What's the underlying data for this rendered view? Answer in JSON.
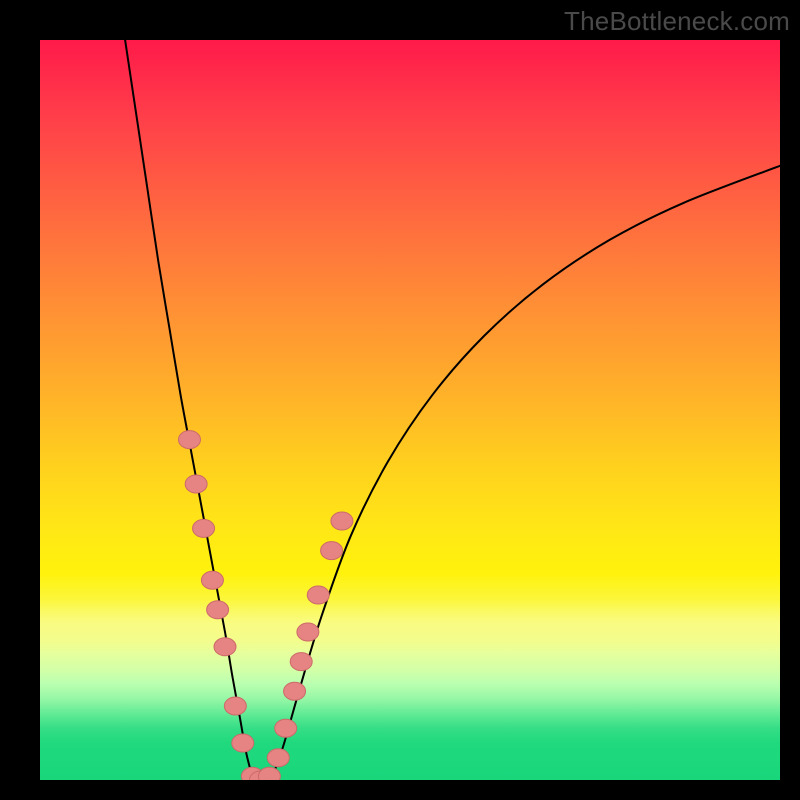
{
  "watermark": "TheBottleneck.com",
  "colors": {
    "frame": "#000000",
    "curve_stroke": "#000000",
    "marker_fill": "#e68383",
    "marker_stroke": "#cc6a6a",
    "gradient_top": "#ff1a4a",
    "gradient_bottom": "#19d67b"
  },
  "chart_data": {
    "type": "line",
    "title": "",
    "xlabel": "",
    "ylabel": "",
    "xlim": [
      0,
      100
    ],
    "ylim": [
      0,
      100
    ],
    "grid": false,
    "legend": null,
    "background": "vertical red→yellow→green gradient; green at bottom (good), red at top (bad)",
    "series": [
      {
        "name": "curve-left",
        "x": [
          11.5,
          13.0,
          14.5,
          16.0,
          17.5,
          19.0,
          20.5,
          22.0,
          23.5,
          25.0,
          26.0,
          27.0,
          27.8,
          28.4
        ],
        "y": [
          100,
          90,
          80,
          70,
          61,
          52,
          44,
          36,
          28,
          20,
          14,
          8.5,
          4,
          1.5
        ]
      },
      {
        "name": "curve-trough",
        "x": [
          28.4,
          29.0,
          30.0,
          31.0,
          31.8
        ],
        "y": [
          1.5,
          0,
          0,
          0,
          1.5
        ]
      },
      {
        "name": "curve-right",
        "x": [
          31.8,
          33.0,
          35.0,
          38.0,
          42.0,
          47.0,
          53.0,
          60.0,
          68.0,
          77.0,
          87.0,
          100.0
        ],
        "y": [
          1.5,
          5,
          12,
          22,
          33,
          43,
          52,
          60,
          67,
          73,
          78,
          83
        ]
      }
    ],
    "markers": [
      {
        "series": "left",
        "x": 20.2,
        "y": 46
      },
      {
        "series": "left",
        "x": 21.1,
        "y": 40
      },
      {
        "series": "left",
        "x": 22.1,
        "y": 34
      },
      {
        "series": "left",
        "x": 23.3,
        "y": 27
      },
      {
        "series": "left",
        "x": 24.0,
        "y": 23
      },
      {
        "series": "left",
        "x": 25.0,
        "y": 18
      },
      {
        "series": "left",
        "x": 26.4,
        "y": 10
      },
      {
        "series": "left",
        "x": 27.4,
        "y": 5
      },
      {
        "series": "trough",
        "x": 28.7,
        "y": 0.5
      },
      {
        "series": "trough",
        "x": 29.8,
        "y": 0
      },
      {
        "series": "trough",
        "x": 31.0,
        "y": 0.5
      },
      {
        "series": "right",
        "x": 32.2,
        "y": 3
      },
      {
        "series": "right",
        "x": 33.2,
        "y": 7
      },
      {
        "series": "right",
        "x": 34.4,
        "y": 12
      },
      {
        "series": "right",
        "x": 35.3,
        "y": 16
      },
      {
        "series": "right",
        "x": 36.2,
        "y": 20
      },
      {
        "series": "right",
        "x": 37.6,
        "y": 25
      },
      {
        "series": "right",
        "x": 39.4,
        "y": 31
      },
      {
        "series": "right",
        "x": 40.8,
        "y": 35
      }
    ]
  }
}
